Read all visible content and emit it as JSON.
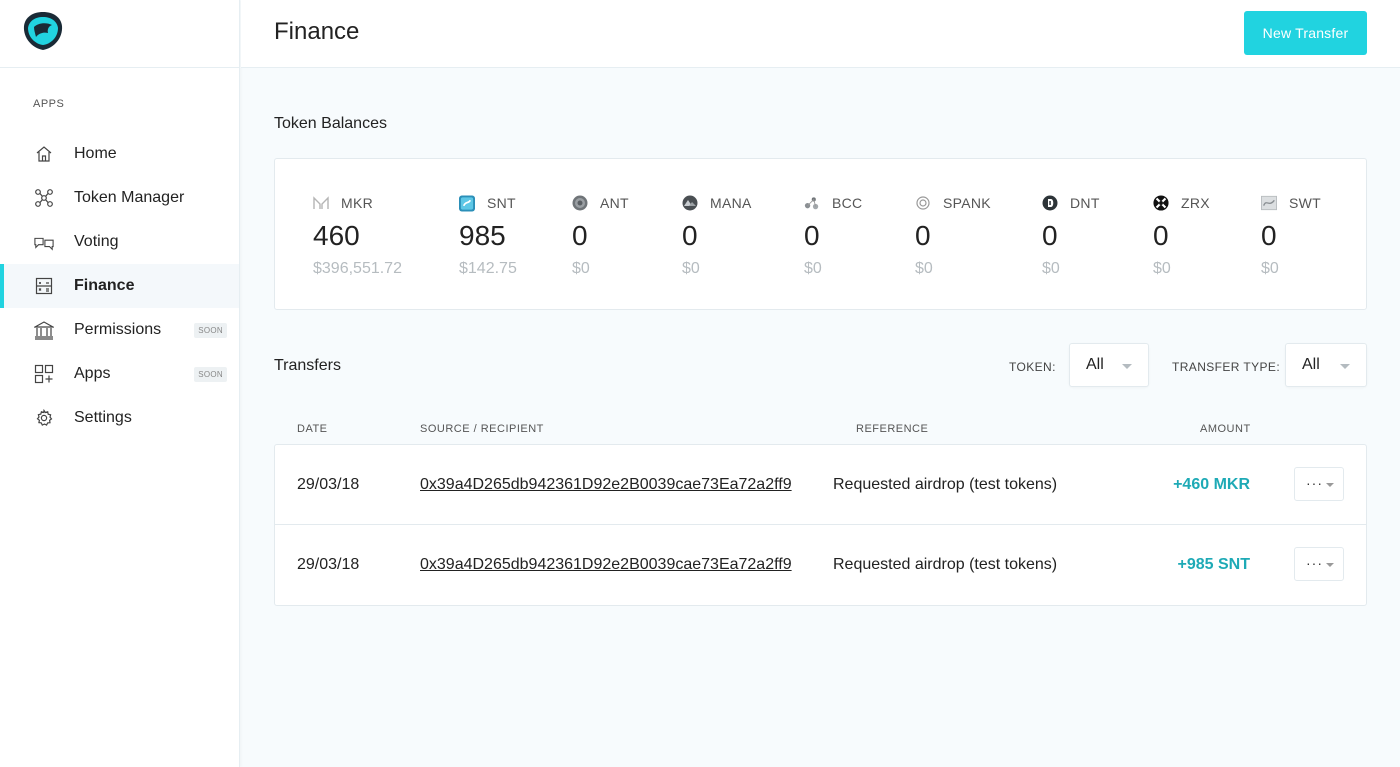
{
  "sidebar": {
    "logo_icon": "aragon-eagle-icon",
    "section_label": "APPS",
    "items": [
      {
        "label": "Home",
        "icon": "home-icon"
      },
      {
        "label": "Token Manager",
        "icon": "token-manager-icon"
      },
      {
        "label": "Voting",
        "icon": "voting-icon"
      },
      {
        "label": "Finance",
        "icon": "finance-icon",
        "active": true
      },
      {
        "label": "Permissions",
        "icon": "permissions-icon",
        "badge": "SOON"
      },
      {
        "label": "Apps",
        "icon": "apps-icon",
        "badge": "SOON"
      },
      {
        "label": "Settings",
        "icon": "settings-icon"
      }
    ]
  },
  "header": {
    "title": "Finance",
    "new_transfer_label": "New Transfer"
  },
  "colors": {
    "accent": "#21d3e0",
    "amount_positive": "#1eaab6"
  },
  "balances": {
    "title": "Token Balances",
    "tokens": [
      {
        "symbol": "MKR",
        "amount": "460",
        "usd": "$396,551.72",
        "icon": "mkr-icon"
      },
      {
        "symbol": "SNT",
        "amount": "985",
        "usd": "$142.75",
        "icon": "snt-icon"
      },
      {
        "symbol": "ANT",
        "amount": "0",
        "usd": "$0",
        "icon": "ant-icon"
      },
      {
        "symbol": "MANA",
        "amount": "0",
        "usd": "$0",
        "icon": "mana-icon"
      },
      {
        "symbol": "BCC",
        "amount": "0",
        "usd": "$0",
        "icon": "bcc-icon"
      },
      {
        "symbol": "SPANK",
        "amount": "0",
        "usd": "$0",
        "icon": "spank-icon"
      },
      {
        "symbol": "DNT",
        "amount": "0",
        "usd": "$0",
        "icon": "dnt-icon"
      },
      {
        "symbol": "ZRX",
        "amount": "0",
        "usd": "$0",
        "icon": "zrx-icon"
      },
      {
        "symbol": "SWT",
        "amount": "0",
        "usd": "$0",
        "icon": "swt-icon"
      }
    ]
  },
  "transfers": {
    "title": "Transfers",
    "token_filter_label": "TOKEN:",
    "token_filter_value": "All",
    "type_filter_label": "TRANSFER TYPE:",
    "type_filter_value": "All",
    "columns": {
      "date": "DATE",
      "source": "SOURCE / RECIPIENT",
      "reference": "REFERENCE",
      "amount": "AMOUNT"
    },
    "rows": [
      {
        "date": "29/03/18",
        "address": "0x39a4D265db942361D92e2B0039cae73Ea72a2ff9",
        "reference": "Requested airdrop (test tokens)",
        "amount": "+460 MKR",
        "menu": "···"
      },
      {
        "date": "29/03/18",
        "address": "0x39a4D265db942361D92e2B0039cae73Ea72a2ff9",
        "reference": "Requested airdrop (test tokens)",
        "amount": "+985 SNT",
        "menu": "···"
      }
    ]
  }
}
